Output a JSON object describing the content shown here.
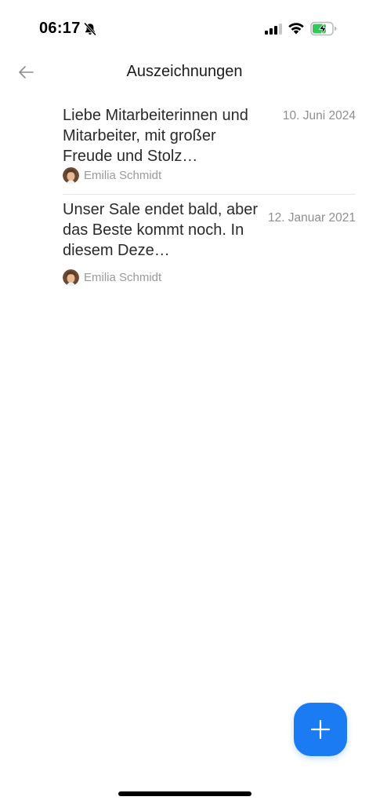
{
  "status_bar": {
    "time": "06:17",
    "icons": [
      "bell-slash-icon",
      "cellular-signal-icon",
      "wifi-icon",
      "battery-charging-icon"
    ],
    "battery_color": "#34c759"
  },
  "header": {
    "title": "Auszeichnungen",
    "back_icon": "arrow-left-icon"
  },
  "awards": [
    {
      "text": "Liebe Mitarbeiterinnen und Mitarbeiter,  mit großer Freude und Stolz…",
      "date": "10. Juni 2024",
      "author": "Emilia Schmidt"
    },
    {
      "text": "Unser Sale endet bald, aber das Beste kommt noch. In diesem Deze…",
      "date": "12. Januar 2021",
      "author": "Emilia Schmidt"
    }
  ],
  "fab": {
    "icon": "plus-icon",
    "color": "#1a7bf2"
  }
}
